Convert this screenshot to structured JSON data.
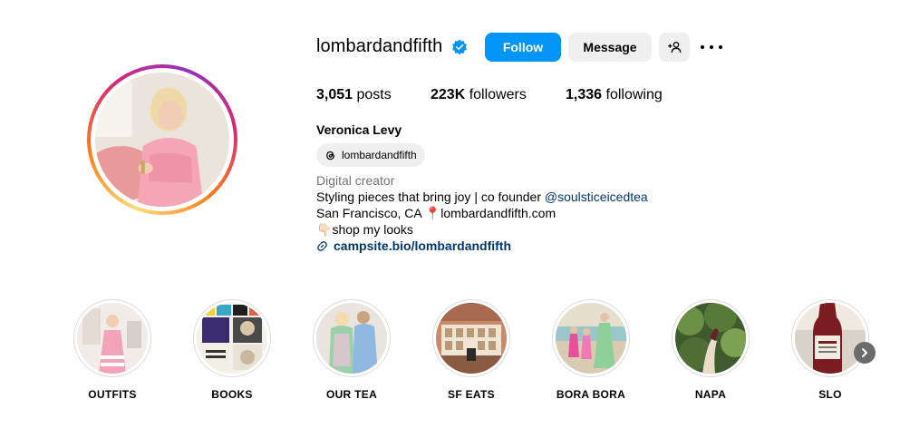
{
  "profile": {
    "username": "lombardandfifth",
    "verified": true,
    "full_name": "Veronica Levy",
    "threads_handle": "lombardandfifth",
    "category": "Digital creator",
    "bio_line1_prefix": "Styling pieces that bring joy | co founder ",
    "bio_mention": "@soulsticeicedtea",
    "bio_line2_prefix": "San Francisco, CA ",
    "bio_line2_pin": "📍",
    "bio_line2_suffix": "lombardandfifth.com",
    "bio_line3_emoji": "👇🏻",
    "bio_line3_text": "shop my looks",
    "link": "campsite.bio/lombardandfifth"
  },
  "buttons": {
    "follow": "Follow",
    "message": "Message"
  },
  "stats": {
    "posts_count": "3,051",
    "posts_label": " posts",
    "followers_count": "223K",
    "followers_label": " followers",
    "following_count": "1,336",
    "following_label": " following"
  },
  "highlights": [
    {
      "label": "OUTFITS"
    },
    {
      "label": "BOOKS"
    },
    {
      "label": "OUR TEA"
    },
    {
      "label": "SF EATS"
    },
    {
      "label": "BORA BORA"
    },
    {
      "label": "NAPA"
    },
    {
      "label": "SLO"
    }
  ],
  "colors": {
    "follow_blue": "#0095f6",
    "link_blue": "#00376b",
    "verified_blue": "#0095f6",
    "button_gray": "#efefef"
  },
  "icons": {
    "verified": "verified-badge-icon",
    "add_user": "add-user-icon",
    "more": "more-options-icon",
    "threads": "threads-icon",
    "link": "link-icon",
    "next": "chevron-right-icon"
  }
}
